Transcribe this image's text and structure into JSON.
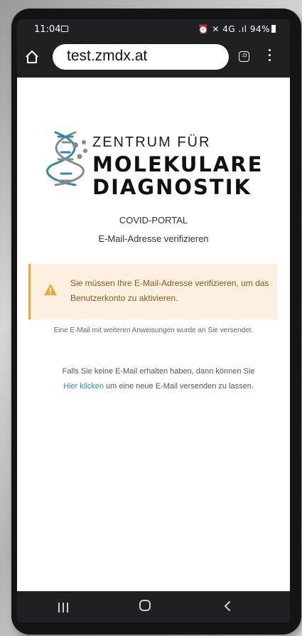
{
  "status_bar": {
    "time": "11:04",
    "right_text": "⏰ ✕ 4G .ıl 94%",
    "battery": "94%"
  },
  "browser": {
    "url": "test.zmdx.at",
    "tabs_count": ":D"
  },
  "logo": {
    "line1": "ZENTRUM FÜR",
    "line2": "MOLEKULARE",
    "line3": "DIAGNOSTIK",
    "accent_color": "#2f8aa8",
    "gray_color": "#8a8a8a"
  },
  "page": {
    "portal_title": "COVID-PORTAL",
    "verify_title": "E-Mail-Adresse verifizieren",
    "alert_text": "Sie müssen Ihre E-Mail-Adresse verifizieren, um das Benutzerkonto zu aktivieren.",
    "info_text": "Eine E-Mail mit weiteren Anweisungen wurde an Sie versendet.",
    "resend_prefix": "Falls Sie keine E-Mail erhalten haben, dann können Sie",
    "resend_link": "Hier klicken",
    "resend_suffix": " um eine neue E-Mail versenden zu lassen."
  },
  "colors": {
    "alert_bg": "#fdf0e1",
    "alert_border": "#f0a630",
    "link": "#2a8fd0"
  },
  "icons": {
    "home": "home-icon",
    "tabs": "tabs-icon",
    "menu": "more-vert-icon",
    "warning": "warning-icon",
    "nav_recent": "recent-apps-icon",
    "nav_home": "home-circle-icon",
    "nav_back": "back-icon"
  }
}
